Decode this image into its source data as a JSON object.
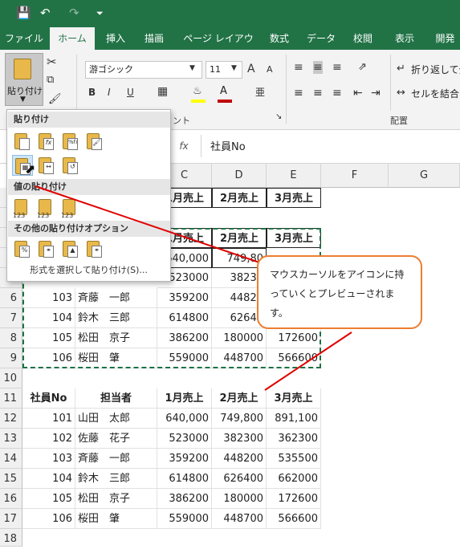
{
  "titlebar": {
    "save_icon": "save-icon",
    "undo_icon": "undo-icon",
    "redo_icon": "redo-icon",
    "customize_icon": "customize-icon"
  },
  "tabs": [
    "ファイル",
    "ホーム",
    "挿入",
    "描画",
    "ページ レイアウト",
    "数式",
    "データ",
    "校閲",
    "表示",
    "開発"
  ],
  "ribbon": {
    "paste_label": "貼り付け",
    "font_name": "游ゴシック",
    "font_size": "11",
    "bold": "B",
    "italic": "I",
    "underline": "U",
    "wrap_text": "折り返して全",
    "merge_center": "セルを結合し",
    "font_group_suffix": "ント",
    "alignment_group": "配置",
    "grow_font": "A",
    "shrink_font": "A",
    "font_color_letter": "A",
    "accent_colors": {
      "highlight": "#ffff00",
      "font_color": "#c00000",
      "brand": "#217346"
    }
  },
  "formula_bar": {
    "fx": "fx",
    "content": "社員No"
  },
  "paste_menu": {
    "section_paste": "貼り付け",
    "section_values": "値の貼り付け",
    "section_other": "その他の貼り付けオプション",
    "paste_special": "形式を選択して貼り付け(S)...",
    "values_badge": "123",
    "formula_badge": "fx",
    "percent_badge": "%fx"
  },
  "columns": [
    "C",
    "D",
    "E",
    "F",
    "G"
  ],
  "visible_headers": [
    "1月売上",
    "2月売上",
    "3月売上"
  ],
  "rows_top": [
    {
      "row": "",
      "cells": [
        "",
        "1月売上",
        "2月売上",
        "3月売上"
      ]
    },
    {
      "row": "",
      "cells": [
        "",
        "",
        "",
        ""
      ]
    },
    {
      "row": "",
      "cells": [
        "",
        "1月売上",
        "2月売上",
        "3月売上"
      ]
    },
    {
      "row": "",
      "cells": [
        "",
        "640,000",
        "749,80",
        ""
      ]
    },
    {
      "row": "",
      "cells": [
        "",
        "523000",
        "38230",
        ""
      ]
    },
    {
      "row": "6",
      "cells": [
        "103",
        "斉藤　一郎",
        "359200",
        "44820"
      ]
    },
    {
      "row": "7",
      "cells": [
        "104",
        "鈴木　三郎",
        "614800",
        "62640"
      ]
    },
    {
      "row": "8",
      "cells": [
        "105",
        "松田　京子",
        "386200",
        "180000",
        "172600"
      ]
    },
    {
      "row": "9",
      "cells": [
        "106",
        "桜田　肇",
        "559000",
        "448700",
        "566600"
      ]
    },
    {
      "row": "10",
      "cells": []
    }
  ],
  "table2": {
    "header_row": "11",
    "headers": [
      "社員No",
      "担当者",
      "1月売上",
      "2月売上",
      "3月売上"
    ],
    "rows": [
      {
        "row": "12",
        "id": "101",
        "name": "山田　太郎",
        "m1": "640,000",
        "m2": "749,800",
        "m3": "891,100"
      },
      {
        "row": "13",
        "id": "102",
        "name": "佐藤　花子",
        "m1": "523000",
        "m2": "382300",
        "m3": "362300"
      },
      {
        "row": "14",
        "id": "103",
        "name": "斉藤　一郎",
        "m1": "359200",
        "m2": "448200",
        "m3": "535500"
      },
      {
        "row": "15",
        "id": "104",
        "name": "鈴木　三郎",
        "m1": "614800",
        "m2": "626400",
        "m3": "662000"
      },
      {
        "row": "16",
        "id": "105",
        "name": "松田　京子",
        "m1": "386200",
        "m2": "180000",
        "m3": "172600"
      },
      {
        "row": "17",
        "id": "106",
        "name": "桜田　肇",
        "m1": "559000",
        "m2": "448700",
        "m3": "566600"
      }
    ],
    "trailing_row": "18"
  },
  "callout_text": "マウスカーソルをアイコンに持っていくとプレビューされます。"
}
